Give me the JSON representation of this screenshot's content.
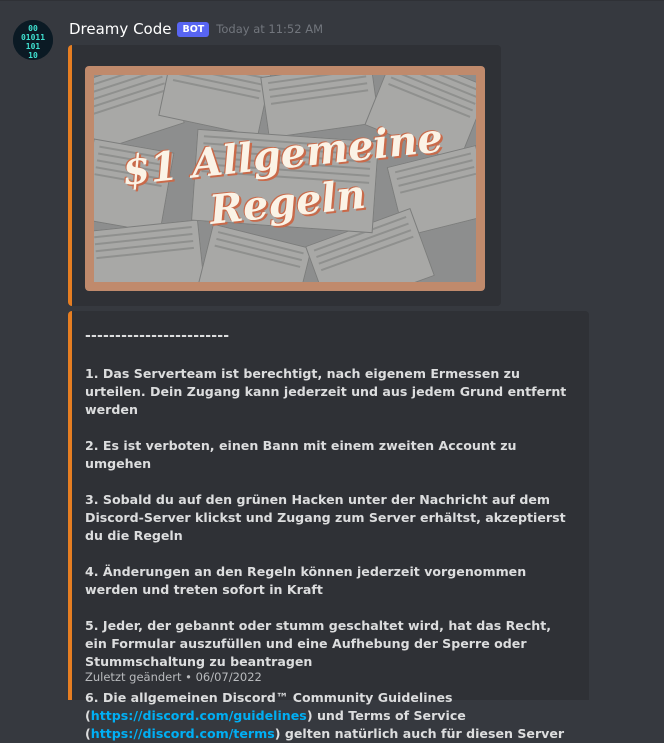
{
  "message": {
    "author": "Dreamy Code",
    "bot_tag": "BOT",
    "timestamp": "Today at 11:52 AM",
    "avatar": {
      "icon": "binary-code-avatar",
      "rows": [
        "00",
        "01011",
        "101",
        "10"
      ]
    }
  },
  "embed_image": {
    "title_line1": "$1 Allgemeine",
    "title_line2": "Regeln",
    "accent_color": "#e67e22"
  },
  "rules_embed": {
    "separator": "------------------------",
    "rules": [
      {
        "text": "1. Das Serverteam ist berechtigt, nach eigenem Ermessen zu urteilen. Dein Zugang kann jederzeit und aus jedem Grund entfernt werden"
      },
      {
        "text": "2. Es ist verboten, einen Bann mit einem zweiten Account zu umgehen"
      },
      {
        "text": "3. Sobald du auf den grünen Hacken unter der Nachricht auf dem Discord-Server klickst und Zugang zum Server erhältst, akzeptierst du die Regeln"
      },
      {
        "text": "4. Änderungen an den Regeln können jederzeit vorgenommen werden und treten sofort in Kraft"
      },
      {
        "text": "5. Jeder, der gebannt oder stumm geschaltet wird, hat das Recht, ein Formular auszufüllen und eine Aufhebung der Sperre oder Stummschaltung zu beantragen"
      }
    ],
    "rule6": {
      "intro": "6. Die allgemeinen Discord™ Community Guidelines",
      "open1": "(",
      "link1": "https://discord.com/guidelines",
      "mid": ") und Terms of Service",
      "open2": "(",
      "link2": "https://discord.com/terms",
      "end": ") gelten natürlich auch für diesen Server"
    },
    "footer_label": "Zuletzt geändert",
    "footer_sep": "•",
    "footer_date": "06/07/2022"
  }
}
